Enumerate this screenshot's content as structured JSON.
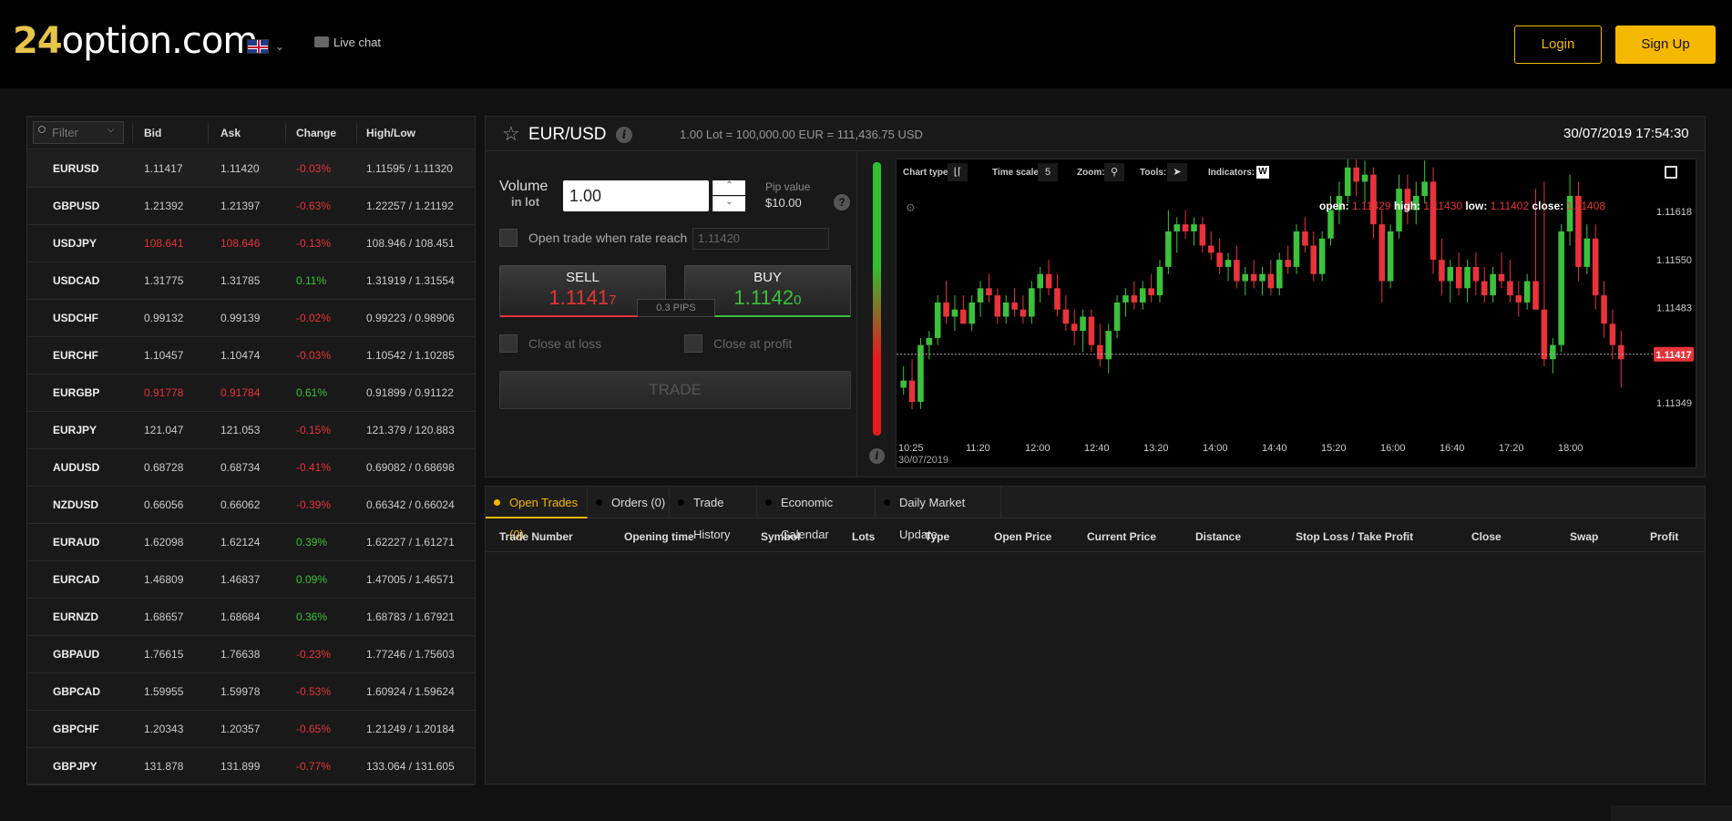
{
  "header": {
    "logo_digits": "24",
    "logo_text": "option.com",
    "live_chat": "Live chat",
    "login": "Login",
    "signup": "Sign Up"
  },
  "assets": {
    "filter_placeholder": "Filter",
    "columns": [
      "Bid",
      "Ask",
      "Change",
      "High/Low"
    ],
    "rows": [
      {
        "symbol": "EURUSD",
        "bid": "1.11417",
        "ask": "1.11420",
        "change": "-0.03%",
        "hl": "1.11595 / 1.11320",
        "dir": "neg",
        "rate_dir": ""
      },
      {
        "symbol": "GBPUSD",
        "bid": "1.21392",
        "ask": "1.21397",
        "change": "-0.63%",
        "hl": "1.22257 / 1.21192",
        "dir": "neg",
        "rate_dir": ""
      },
      {
        "symbol": "USDJPY",
        "bid": "108.641",
        "ask": "108.646",
        "change": "-0.13%",
        "hl": "108.946 / 108.451",
        "dir": "neg",
        "rate_dir": "neg"
      },
      {
        "symbol": "USDCAD",
        "bid": "1.31775",
        "ask": "1.31785",
        "change": "0.11%",
        "hl": "1.31919 / 1.31554",
        "dir": "pos",
        "rate_dir": ""
      },
      {
        "symbol": "USDCHF",
        "bid": "0.99132",
        "ask": "0.99139",
        "change": "-0.02%",
        "hl": "0.99223 / 0.98906",
        "dir": "neg",
        "rate_dir": ""
      },
      {
        "symbol": "EURCHF",
        "bid": "1.10457",
        "ask": "1.10474",
        "change": "-0.03%",
        "hl": "1.10542 / 1.10285",
        "dir": "neg",
        "rate_dir": ""
      },
      {
        "symbol": "EURGBP",
        "bid": "0.91778",
        "ask": "0.91784",
        "change": "0.61%",
        "hl": "0.91899 / 0.91122",
        "dir": "pos",
        "rate_dir": "neg"
      },
      {
        "symbol": "EURJPY",
        "bid": "121.047",
        "ask": "121.053",
        "change": "-0.15%",
        "hl": "121.379 / 120.883",
        "dir": "neg",
        "rate_dir": ""
      },
      {
        "symbol": "AUDUSD",
        "bid": "0.68728",
        "ask": "0.68734",
        "change": "-0.41%",
        "hl": "0.69082 / 0.68698",
        "dir": "neg",
        "rate_dir": ""
      },
      {
        "symbol": "NZDUSD",
        "bid": "0.66056",
        "ask": "0.66062",
        "change": "-0.39%",
        "hl": "0.66342 / 0.66024",
        "dir": "neg",
        "rate_dir": ""
      },
      {
        "symbol": "EURAUD",
        "bid": "1.62098",
        "ask": "1.62124",
        "change": "0.39%",
        "hl": "1.62227 / 1.61271",
        "dir": "pos",
        "rate_dir": ""
      },
      {
        "symbol": "EURCAD",
        "bid": "1.46809",
        "ask": "1.46837",
        "change": "0.09%",
        "hl": "1.47005 / 1.46571",
        "dir": "pos",
        "rate_dir": ""
      },
      {
        "symbol": "EURNZD",
        "bid": "1.68657",
        "ask": "1.68684",
        "change": "0.36%",
        "hl": "1.68783 / 1.67921",
        "dir": "pos",
        "rate_dir": ""
      },
      {
        "symbol": "GBPAUD",
        "bid": "1.76615",
        "ask": "1.76638",
        "change": "-0.23%",
        "hl": "1.77246 / 1.75603",
        "dir": "neg",
        "rate_dir": ""
      },
      {
        "symbol": "GBPCAD",
        "bid": "1.59955",
        "ask": "1.59978",
        "change": "-0.53%",
        "hl": "1.60924 / 1.59624",
        "dir": "neg",
        "rate_dir": ""
      },
      {
        "symbol": "GBPCHF",
        "bid": "1.20343",
        "ask": "1.20357",
        "change": "-0.65%",
        "hl": "1.21249 / 1.20184",
        "dir": "neg",
        "rate_dir": ""
      },
      {
        "symbol": "GBPJPY",
        "bid": "131.878",
        "ask": "131.899",
        "change": "-0.77%",
        "hl": "133.064 / 131.605",
        "dir": "neg",
        "rate_dir": ""
      }
    ]
  },
  "instrument": {
    "pair": "EUR/USD",
    "lot_info": "1.00 Lot = 100,000.00 EUR = 111,436.75 USD",
    "datetime": "30/07/2019 17:54:30"
  },
  "trade_form": {
    "volume_label": "Volume",
    "volume_sub": "in lot",
    "volume_value": "1.00",
    "pip_label": "Pip value",
    "pip_value": "$10.00",
    "open_when_label": "Open trade when rate reach",
    "rate_placeholder": "1.11420",
    "sell_label": "SELL",
    "sell_price_main": "1.1141",
    "sell_price_small": "7",
    "buy_label": "BUY",
    "buy_price_main": "1.1142",
    "buy_price_small": "0",
    "pips": "0.3 PIPS",
    "close_loss": "Close at loss",
    "close_profit": "Close at profit",
    "trade_button": "TRADE"
  },
  "chart_toolbar": {
    "chart_type": "Chart type:",
    "time_scale": "Time scale",
    "time_scale_value": "5",
    "zoom": "Zoom:",
    "tools": "Tools:",
    "indicators": "Indicators:",
    "indicators_badge": "W"
  },
  "chart_data": {
    "type": "candlestick",
    "ohlc_readout": {
      "open": "1.11429",
      "high": "1.11430",
      "low": "1.11402",
      "close": "1.11408"
    },
    "current_price": "1.11417",
    "y_ticks": [
      "1.11618",
      "1.11550",
      "1.11483",
      "1.11349"
    ],
    "x_ticks": [
      "10:25",
      "11:20",
      "12:00",
      "12:40",
      "13:20",
      "14:00",
      "14:40",
      "15:20",
      "16:00",
      "16:40",
      "17:20",
      "18:00"
    ],
    "x_date": "30/07/2019",
    "ylim": [
      1.113,
      1.1164
    ],
    "candles": [
      [
        1.1137,
        1.114,
        1.1136,
        1.1138
      ],
      [
        1.1138,
        1.1141,
        1.1134,
        1.1135
      ],
      [
        1.1135,
        1.1144,
        1.1134,
        1.1143
      ],
      [
        1.1143,
        1.1145,
        1.1141,
        1.1144
      ],
      [
        1.1144,
        1.115,
        1.1143,
        1.1149
      ],
      [
        1.1149,
        1.1152,
        1.1146,
        1.1147
      ],
      [
        1.1147,
        1.115,
        1.1145,
        1.1148
      ],
      [
        1.1148,
        1.115,
        1.1146,
        1.1146
      ],
      [
        1.1146,
        1.115,
        1.1145,
        1.1149
      ],
      [
        1.1149,
        1.1152,
        1.1147,
        1.1151
      ],
      [
        1.1151,
        1.1153,
        1.1149,
        1.115
      ],
      [
        1.115,
        1.1151,
        1.1146,
        1.1147
      ],
      [
        1.1147,
        1.115,
        1.1146,
        1.1149
      ],
      [
        1.1149,
        1.1151,
        1.1147,
        1.1148
      ],
      [
        1.1148,
        1.115,
        1.1146,
        1.1147
      ],
      [
        1.1147,
        1.1152,
        1.1146,
        1.1151
      ],
      [
        1.1151,
        1.1154,
        1.1149,
        1.1153
      ],
      [
        1.1153,
        1.1155,
        1.115,
        1.1151
      ],
      [
        1.1151,
        1.1153,
        1.1147,
        1.1148
      ],
      [
        1.1148,
        1.115,
        1.1145,
        1.1146
      ],
      [
        1.1146,
        1.1148,
        1.1143,
        1.1145
      ],
      [
        1.1145,
        1.1148,
        1.1142,
        1.1147
      ],
      [
        1.1147,
        1.1148,
        1.1142,
        1.1143
      ],
      [
        1.1143,
        1.1146,
        1.114,
        1.1141
      ],
      [
        1.1141,
        1.1146,
        1.1139,
        1.1145
      ],
      [
        1.1145,
        1.115,
        1.1144,
        1.1149
      ],
      [
        1.1149,
        1.1151,
        1.1147,
        1.115
      ],
      [
        1.115,
        1.1152,
        1.1148,
        1.1149
      ],
      [
        1.1149,
        1.1152,
        1.1148,
        1.1151
      ],
      [
        1.1151,
        1.1153,
        1.1149,
        1.115
      ],
      [
        1.115,
        1.1155,
        1.1149,
        1.1154
      ],
      [
        1.1154,
        1.1162,
        1.1153,
        1.1159
      ],
      [
        1.1159,
        1.1161,
        1.1156,
        1.116
      ],
      [
        1.116,
        1.1162,
        1.1158,
        1.1159
      ],
      [
        1.1159,
        1.1161,
        1.1157,
        1.116
      ],
      [
        1.116,
        1.1161,
        1.1156,
        1.1157
      ],
      [
        1.1157,
        1.1159,
        1.1155,
        1.1156
      ],
      [
        1.1156,
        1.1158,
        1.1153,
        1.1154
      ],
      [
        1.1154,
        1.1156,
        1.1152,
        1.1155
      ],
      [
        1.1155,
        1.1157,
        1.1151,
        1.1152
      ],
      [
        1.1152,
        1.1154,
        1.115,
        1.1153
      ],
      [
        1.1153,
        1.1155,
        1.1151,
        1.1152
      ],
      [
        1.1152,
        1.1154,
        1.115,
        1.1153
      ],
      [
        1.1153,
        1.1155,
        1.115,
        1.1151
      ],
      [
        1.1151,
        1.1156,
        1.115,
        1.1155
      ],
      [
        1.1155,
        1.1157,
        1.1153,
        1.1154
      ],
      [
        1.1154,
        1.116,
        1.1153,
        1.1159
      ],
      [
        1.1159,
        1.1161,
        1.1156,
        1.1157
      ],
      [
        1.1157,
        1.1159,
        1.1152,
        1.1153
      ],
      [
        1.1153,
        1.1159,
        1.1152,
        1.1158
      ],
      [
        1.1158,
        1.1164,
        1.1157,
        1.1162
      ],
      [
        1.1162,
        1.1166,
        1.116,
        1.1164
      ],
      [
        1.1164,
        1.1172,
        1.1163,
        1.1168
      ],
      [
        1.1168,
        1.117,
        1.1164,
        1.1166
      ],
      [
        1.1166,
        1.1169,
        1.1163,
        1.1167
      ],
      [
        1.1167,
        1.1168,
        1.1158,
        1.116
      ],
      [
        1.116,
        1.1162,
        1.1149,
        1.1152
      ],
      [
        1.1152,
        1.116,
        1.1151,
        1.1159
      ],
      [
        1.1159,
        1.1167,
        1.1158,
        1.1165
      ],
      [
        1.1165,
        1.1167,
        1.116,
        1.1162
      ],
      [
        1.1162,
        1.1166,
        1.116,
        1.1164
      ],
      [
        1.1164,
        1.1169,
        1.1163,
        1.1166
      ],
      [
        1.1166,
        1.1168,
        1.1153,
        1.1155
      ],
      [
        1.1155,
        1.1158,
        1.115,
        1.1152
      ],
      [
        1.1152,
        1.1155,
        1.1149,
        1.1154
      ],
      [
        1.1154,
        1.1156,
        1.115,
        1.1151
      ],
      [
        1.1151,
        1.1155,
        1.1149,
        1.1154
      ],
      [
        1.1154,
        1.1156,
        1.115,
        1.1152
      ],
      [
        1.1152,
        1.1154,
        1.1149,
        1.115
      ],
      [
        1.115,
        1.1154,
        1.1149,
        1.1153
      ],
      [
        1.1153,
        1.1156,
        1.1151,
        1.1152
      ],
      [
        1.1152,
        1.1155,
        1.1149,
        1.115
      ],
      [
        1.115,
        1.1152,
        1.1147,
        1.1149
      ],
      [
        1.1149,
        1.1153,
        1.1148,
        1.1152
      ],
      [
        1.1152,
        1.1165,
        1.1148,
        1.1148
      ],
      [
        1.1148,
        1.1166,
        1.114,
        1.1141
      ],
      [
        1.1141,
        1.1144,
        1.1139,
        1.1143
      ],
      [
        1.1143,
        1.116,
        1.1142,
        1.1159
      ],
      [
        1.1159,
        1.1167,
        1.1157,
        1.1164
      ],
      [
        1.1164,
        1.1166,
        1.1152,
        1.1154
      ],
      [
        1.1154,
        1.116,
        1.1153,
        1.1158
      ],
      [
        1.1158,
        1.116,
        1.1148,
        1.115
      ],
      [
        1.115,
        1.1152,
        1.1144,
        1.1146
      ],
      [
        1.1146,
        1.1148,
        1.1141,
        1.1143
      ],
      [
        1.1143,
        1.1145,
        1.1137,
        1.1141
      ]
    ]
  },
  "bottom_tabs": [
    {
      "label": "Open Trades (0)",
      "active": true
    },
    {
      "label": "Orders (0)",
      "active": false
    },
    {
      "label": "Trade History",
      "active": false
    },
    {
      "label": "Economic Calendar",
      "active": false
    },
    {
      "label": "Daily Market Update",
      "active": false
    }
  ],
  "trade_table_columns": [
    "Trade Number",
    "Opening time",
    "Symbol",
    "Lots",
    "Type",
    "Open Price",
    "Current Price",
    "Distance",
    "Stop Loss / Take Profit",
    "Close",
    "Swap",
    "Profit"
  ],
  "colors": {
    "accent": "#f5b800",
    "up": "#3cc13c",
    "down": "#e8333a"
  }
}
